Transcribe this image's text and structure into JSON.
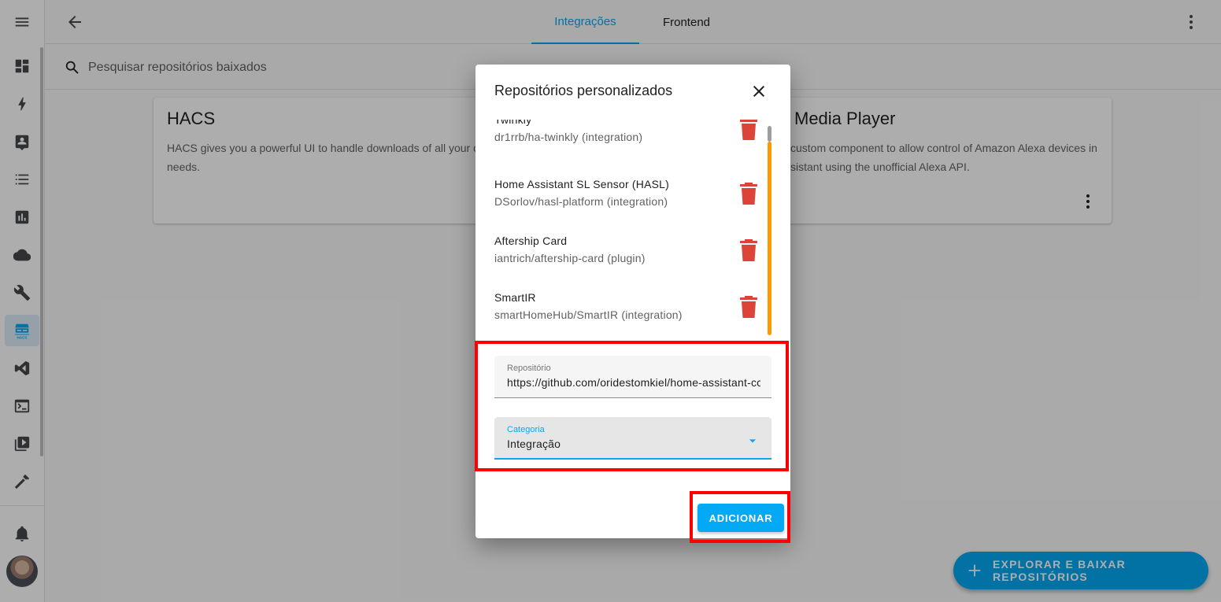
{
  "header": {
    "tabs": [
      "Integrações",
      "Frontend"
    ],
    "active_tab": "Integrações"
  },
  "sidebar": {
    "items": [
      {
        "icon": "menu-icon"
      },
      {
        "icon": "dashboard-icon"
      },
      {
        "icon": "energy-icon"
      },
      {
        "icon": "map-icon"
      },
      {
        "icon": "logbook-icon"
      },
      {
        "icon": "history-icon"
      },
      {
        "icon": "cloud-icon"
      },
      {
        "icon": "wrench-icon"
      },
      {
        "icon": "hacs-icon",
        "label": "HACS",
        "active": true
      },
      {
        "icon": "vscode-icon"
      },
      {
        "icon": "terminal-icon"
      },
      {
        "icon": "media-icon"
      },
      {
        "icon": "hammer-icon"
      },
      {
        "icon": "bell-icon"
      }
    ]
  },
  "search": {
    "placeholder": "Pesquisar repositórios baixados"
  },
  "cards": [
    {
      "title": "HACS",
      "description": "HACS gives you a powerful UI to handle downloads of all your c",
      "description_line2": "needs."
    },
    {
      "title": "Media Player",
      "description": "custom component to allow control of Amazon Alexa devices in",
      "description_line2": "sistant using the unofficial Alexa API."
    }
  ],
  "fab": {
    "label": "EXPLORAR E BAIXAR REPOSITÓRIOS"
  },
  "dialog": {
    "title": "Repositórios personalizados",
    "repositories": [
      {
        "name": "Twinkly",
        "path": "dr1rrb/ha-twinkly (integration)"
      },
      {
        "name": "Home Assistant SL Sensor (HASL)",
        "path": "DSorlov/hasl-platform (integration)"
      },
      {
        "name": "Aftership Card",
        "path": "iantrich/aftership-card (plugin)"
      },
      {
        "name": "SmartIR",
        "path": "smartHomeHub/SmartIR (integration)"
      }
    ],
    "repo_field": {
      "label": "Repositório",
      "value": "https://github.com/oridestomkiel/home-assistant-cc"
    },
    "category_field": {
      "label": "Categoria",
      "value": "Integração"
    },
    "add_button": "ADICIONAR"
  },
  "colors": {
    "accent": "#03a9f4",
    "delete": "#db4437",
    "highlight": "#ff0000",
    "scrollbar": "#ff9800"
  }
}
